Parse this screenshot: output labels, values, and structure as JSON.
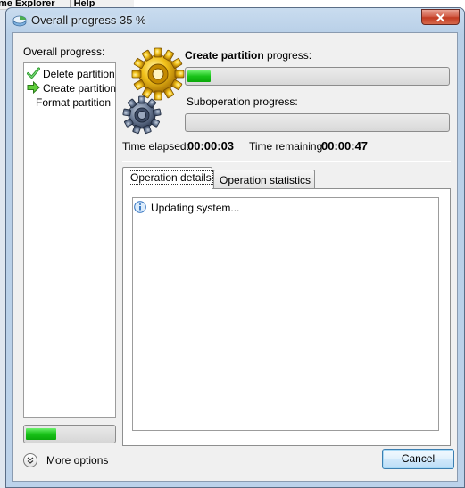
{
  "background_app": {
    "menu_items": [
      "me Explorer",
      "Help"
    ]
  },
  "window": {
    "title": "Overall progress 35 %",
    "close_glyph": "✕",
    "icon": "partition-disk-icon"
  },
  "overall": {
    "label": "Overall progress:",
    "progress": 0.35,
    "steps": [
      {
        "label": "Delete partition",
        "status": "done",
        "icon": "checkmark-icon"
      },
      {
        "label": "Create partition",
        "status": "current",
        "icon": "arrow-right-icon"
      },
      {
        "label": "Format partition",
        "status": "pending",
        "icon": ""
      }
    ]
  },
  "operation": {
    "name": "Create partition",
    "progress_suffix": " progress:",
    "progress": 0.09,
    "sub_label": "Suboperation progress:",
    "sub_progress": 0.0
  },
  "timing": {
    "elapsed_label": "Time elapsed:",
    "elapsed": "00:00:03",
    "remaining_label": "Time remaining:",
    "remaining": "00:00:47"
  },
  "tabs": [
    {
      "label": "Operation details",
      "active": true
    },
    {
      "label": "Operation statistics",
      "active": false
    }
  ],
  "details": {
    "items": [
      {
        "icon": "info-icon",
        "text": "Updating system..."
      }
    ]
  },
  "footer": {
    "more_options_label": "More options",
    "cancel_label": "Cancel"
  },
  "colors": {
    "progress_green": "#19c219",
    "title_bar": "#c9dcef",
    "close_red": "#c23b22"
  }
}
